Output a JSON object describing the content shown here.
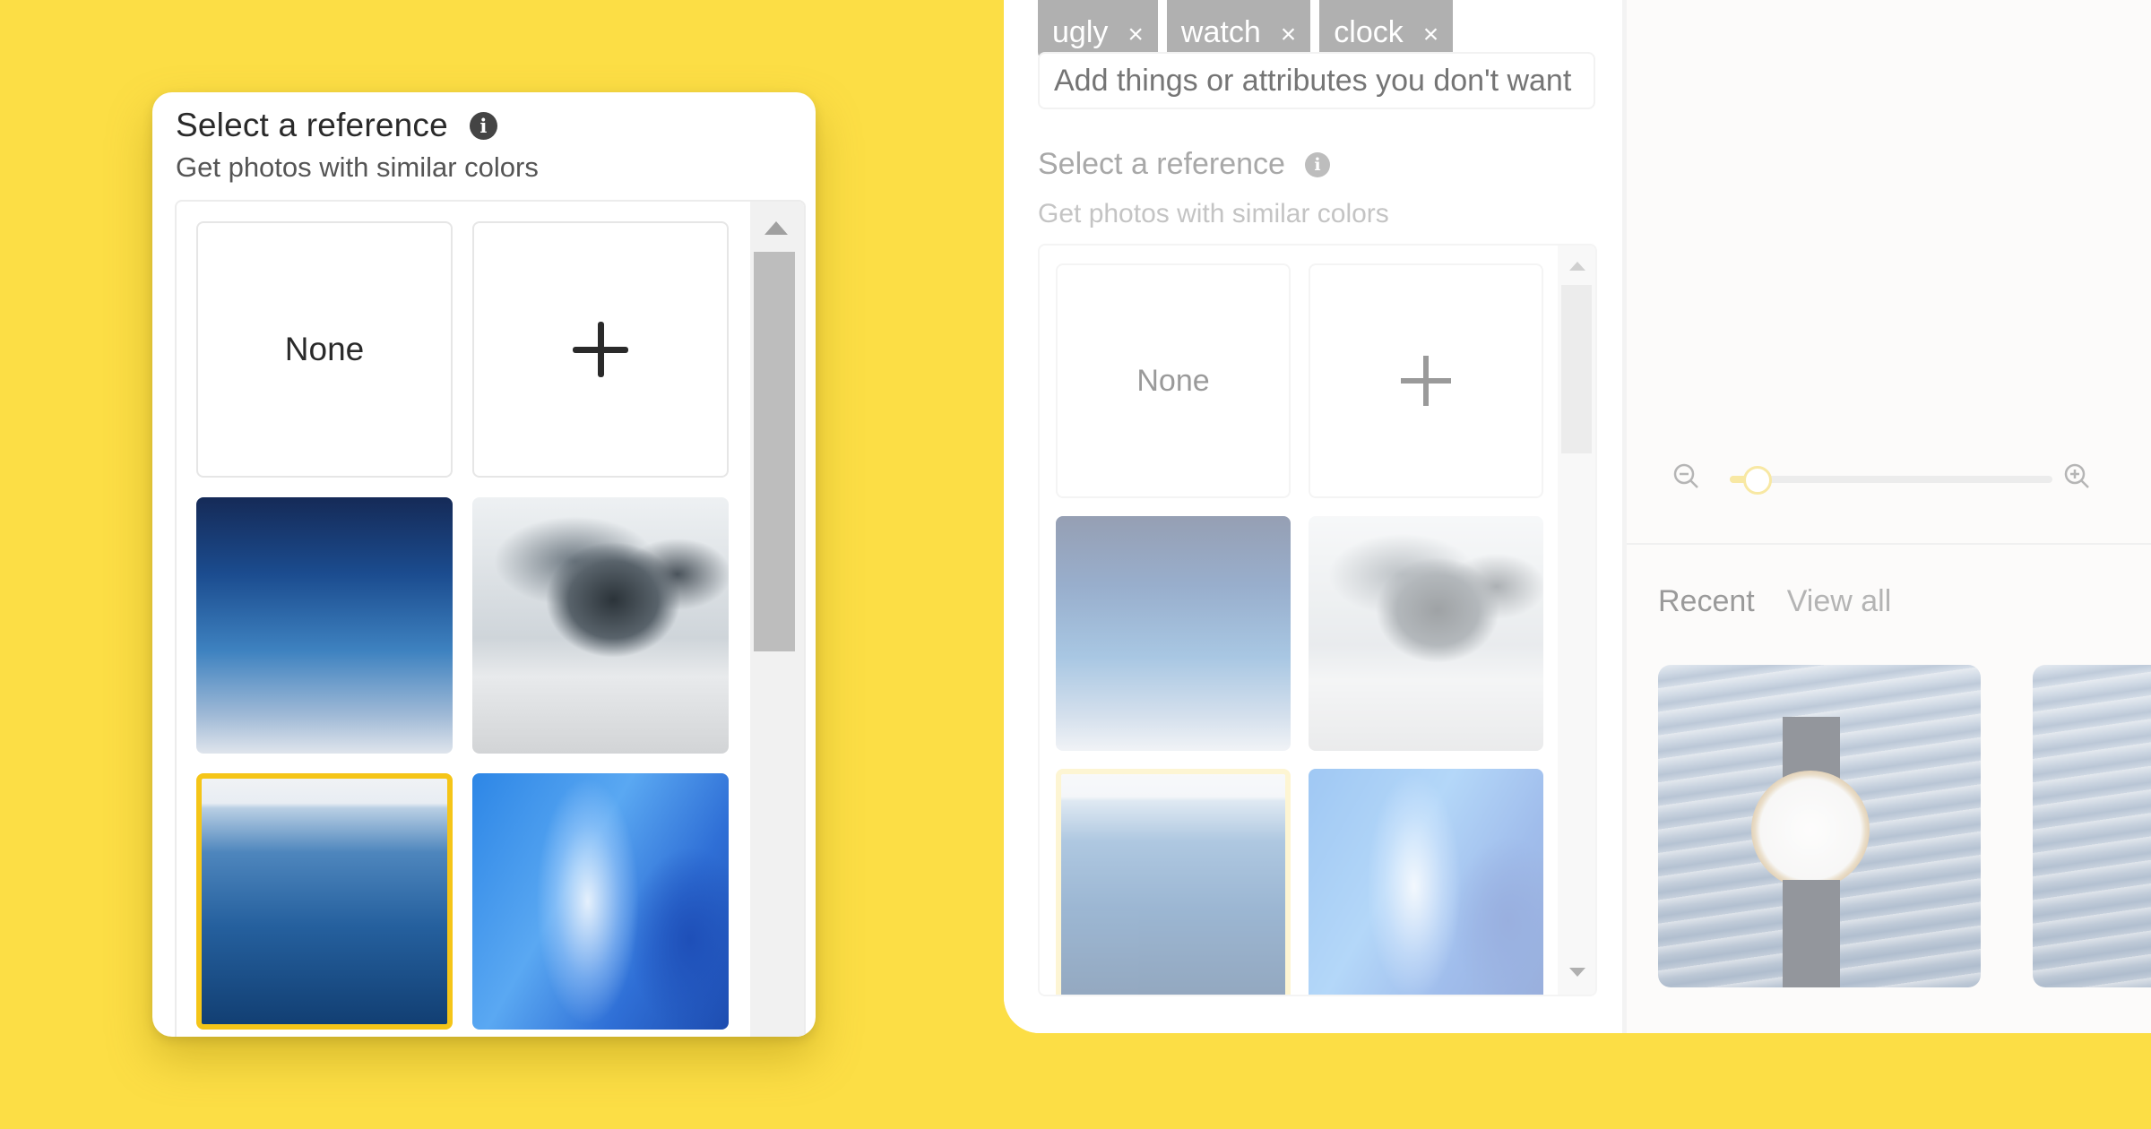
{
  "focused_card": {
    "title": "Select a reference",
    "subtitle": "Get photos with similar colors",
    "tiles": [
      {
        "type": "none",
        "label": "None"
      },
      {
        "type": "add",
        "icon": "plus-icon"
      },
      {
        "type": "image",
        "name": "sky-gradient",
        "selected": false
      },
      {
        "type": "image",
        "name": "snowy-rock",
        "selected": false
      },
      {
        "type": "image",
        "name": "ocean-horizon",
        "selected": true
      },
      {
        "type": "image",
        "name": "blue-wave",
        "selected": false
      }
    ],
    "accent_color": "#F5C518"
  },
  "background_panel": {
    "excluded_tags": [
      {
        "label": "ugly",
        "remove_icon": "×"
      },
      {
        "label": "watch",
        "remove_icon": "×"
      },
      {
        "label": "clock",
        "remove_icon": "×"
      }
    ],
    "exclude_input": {
      "value": "",
      "placeholder": "Add things or attributes you don't want"
    },
    "reference": {
      "title": "Select a reference",
      "subtitle": "Get photos with similar colors",
      "none_label": "None"
    },
    "zoom_slider": {
      "value_fraction": 0.08
    },
    "recent": {
      "tabs": [
        {
          "label": "Recent",
          "active": true
        },
        {
          "label": "View all",
          "active": false
        }
      ]
    }
  },
  "colors": {
    "background": "#FCDE45",
    "selection": "#F5C518"
  }
}
